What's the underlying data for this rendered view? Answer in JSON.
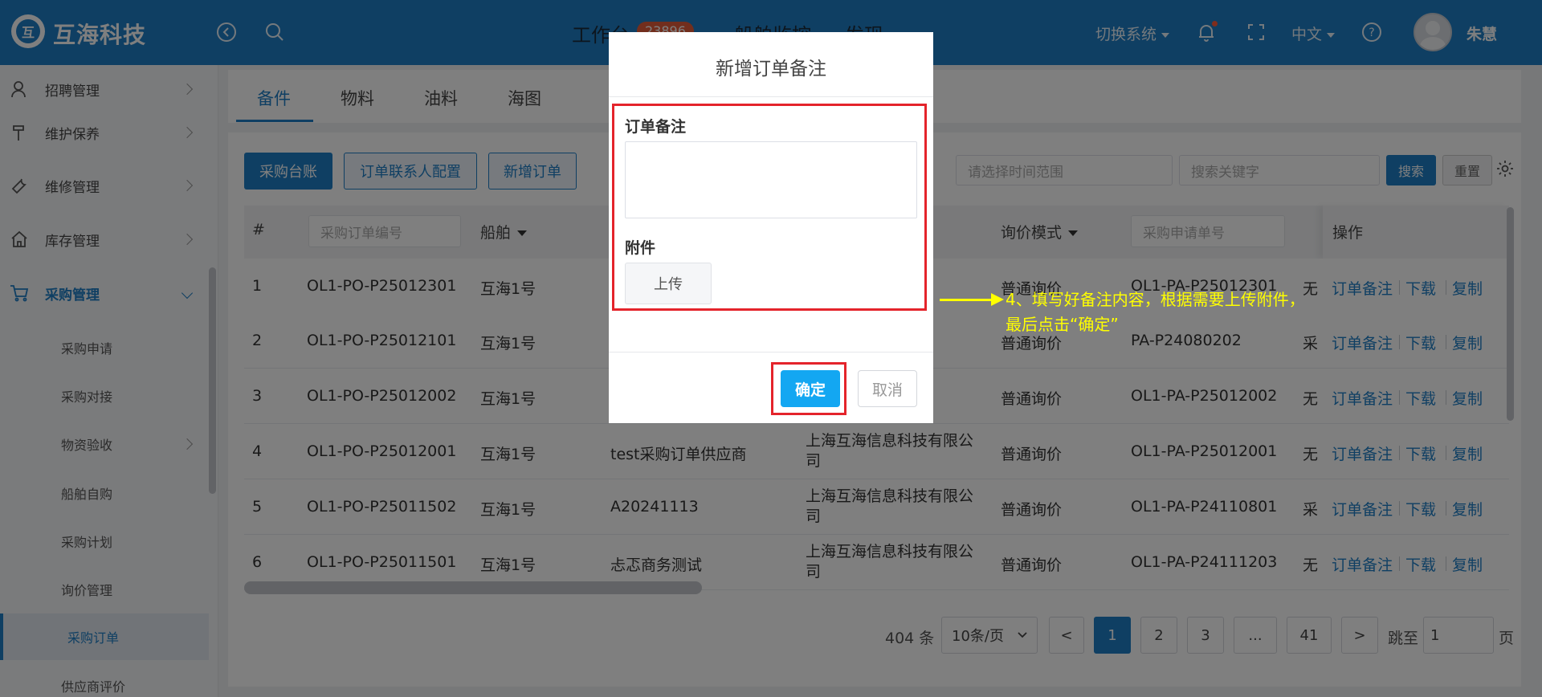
{
  "header": {
    "brand": "互海科技",
    "logo_text": "互",
    "nav": [
      "工作台",
      "船舶监控",
      "发现"
    ],
    "badge": "23896",
    "switch_system": "切换系统",
    "language": "中文",
    "user": "朱慧"
  },
  "sidebar": {
    "items": [
      {
        "label": "招聘管理",
        "icon": "user-icon"
      },
      {
        "label": "维护保养",
        "icon": "hammer-icon"
      },
      {
        "label": "维修管理",
        "icon": "wrench-icon"
      },
      {
        "label": "库存管理",
        "icon": "home-icon"
      },
      {
        "label": "采购管理",
        "icon": "cart-icon"
      }
    ],
    "sub_items": [
      "采购申请",
      "采购对接",
      "物资验收",
      "船舶自购",
      "采购计划",
      "询价管理",
      "采购订单",
      "供应商评价"
    ]
  },
  "tabs": [
    "备件",
    "物料",
    "油料",
    "海图"
  ],
  "toolbar": {
    "purchase_ledger": "采购台账",
    "contact_config": "订单联系人配置",
    "new_order": "新增订单",
    "time_range_placeholder": "请选择时间范围",
    "keyword_placeholder": "搜索关键字",
    "search": "搜索",
    "reset": "重置"
  },
  "table": {
    "headers": {
      "index": "#",
      "order_no_placeholder": "采购订单编号",
      "vessel": "船舶",
      "inquiry_mode": "询价模式",
      "request_no_placeholder": "采购申请单号",
      "ops": "操作"
    },
    "rows": [
      {
        "idx": "1",
        "order_no": "OL1-PO-P25012301",
        "vessel": "互海1号",
        "supplier": "",
        "company": "有限公",
        "mode": "普通询价",
        "req_no": "OL1-PA-P25012301",
        "tail": "无"
      },
      {
        "idx": "2",
        "order_no": "OL1-PO-P25012101",
        "vessel": "互海1号",
        "supplier": "",
        "company": "有限公",
        "mode": "普通询价",
        "req_no": "PA-P24080202",
        "tail": "采"
      },
      {
        "idx": "3",
        "order_no": "OL1-PO-P25012002",
        "vessel": "互海1号",
        "supplier": "",
        "company": "有限公",
        "mode": "普通询价",
        "req_no": "OL1-PA-P25012002",
        "tail": "无"
      },
      {
        "idx": "4",
        "order_no": "OL1-PO-P25012001",
        "vessel": "互海1号",
        "supplier": "test采购订单供应商",
        "company": "上海互海信息科技有限公司",
        "mode": "普通询价",
        "req_no": "OL1-PA-P25012001",
        "tail": "无"
      },
      {
        "idx": "5",
        "order_no": "OL1-PO-P25011502",
        "vessel": "互海1号",
        "supplier": "A20241113",
        "company": "上海互海信息科技有限公司",
        "mode": "普通询价",
        "req_no": "OL1-PA-P24110801",
        "tail": "采"
      },
      {
        "idx": "6",
        "order_no": "OL1-PO-P25011501",
        "vessel": "互海1号",
        "supplier": "忐忑商务测试",
        "company": "上海互海信息科技有限公司",
        "mode": "普通询价",
        "req_no": "OL1-PA-P24111203",
        "tail": "无"
      }
    ],
    "ops": [
      "订单备注",
      "下载",
      "复制"
    ]
  },
  "pager": {
    "total": "404 条",
    "page_size": "10条/页",
    "prev": "<",
    "pages": [
      "1",
      "2",
      "3",
      "...",
      "41"
    ],
    "next": ">",
    "jump_label": "跳至",
    "jump_value": "1",
    "page_unit": "页"
  },
  "modal": {
    "title": "新增订单备注",
    "remark_label": "订单备注",
    "attachment_label": "附件",
    "upload": "上传",
    "confirm": "确定",
    "cancel": "取消"
  },
  "annotation": {
    "line1": "4、填写好备注内容，根据需要上传附件，",
    "line2": "最后点击“确定”"
  },
  "colors": {
    "primary": "#1f7fc6",
    "confirm": "#13a7f2",
    "highlight": "#e4242b",
    "annotation": "#ffff00"
  }
}
